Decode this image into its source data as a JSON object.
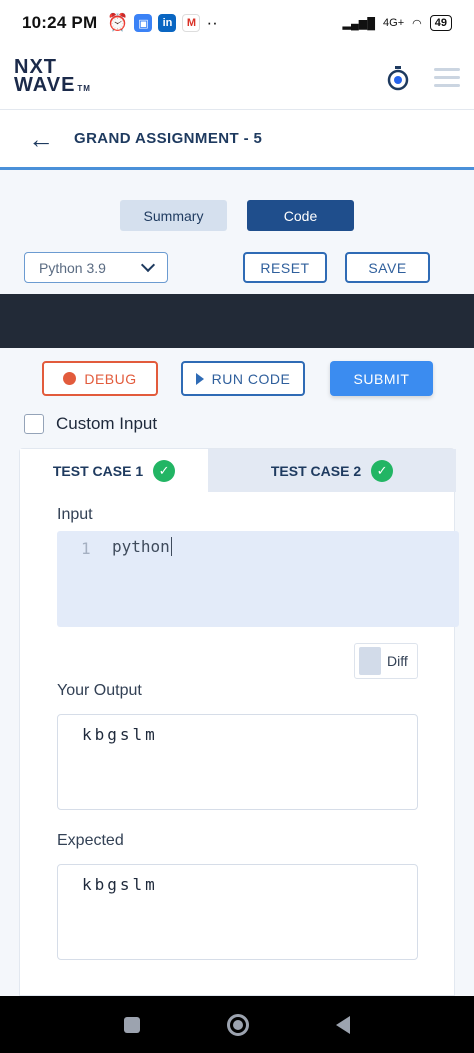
{
  "status_bar": {
    "time": "10:24 PM",
    "battery": "49",
    "network": "4G+"
  },
  "app": {
    "logo_line1": "NXT",
    "logo_line2": "WAVE",
    "logo_tm": "TM"
  },
  "page": {
    "title": "GRAND ASSIGNMENT - 5"
  },
  "view_toggle": {
    "summary": "Summary",
    "code": "Code",
    "active": "Code"
  },
  "toolbar": {
    "language": "Python 3.9",
    "reset": "RESET",
    "save": "SAVE"
  },
  "actions": {
    "debug": "DEBUG",
    "run": "RUN CODE",
    "submit": "SUBMIT"
  },
  "custom_input": {
    "label": "Custom Input",
    "checked": false
  },
  "test_cases": {
    "tabs": [
      {
        "label": "TEST CASE 1",
        "passed": true,
        "active": true
      },
      {
        "label": "TEST CASE 2",
        "passed": true,
        "active": false
      }
    ],
    "input_label": "Input",
    "input_line_number": "1",
    "input_value": "python",
    "diff_label": "Diff",
    "output_label": "Your Output",
    "output_value": "kbgslm",
    "expected_label": "Expected",
    "expected_value": "kbgslm"
  },
  "colors": {
    "primary": "#1f4e8c",
    "accent": "#3b8cf0",
    "debug": "#e25b3c",
    "success": "#22b564"
  }
}
